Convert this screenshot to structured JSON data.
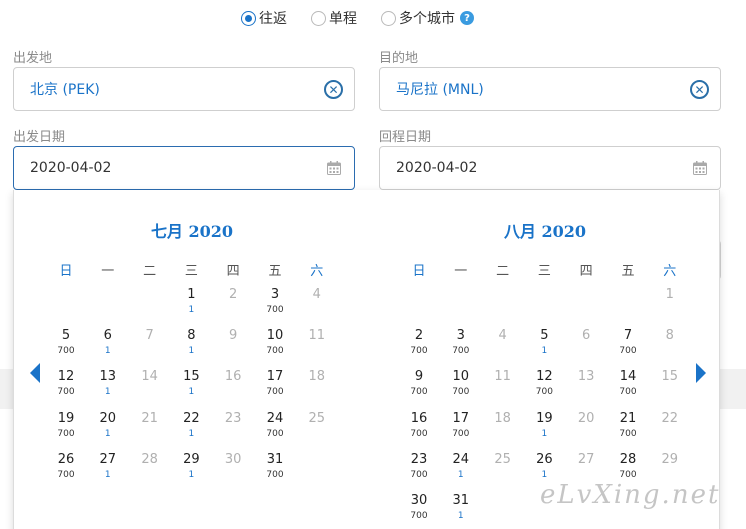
{
  "trip_types": [
    {
      "label": "往返",
      "checked": true
    },
    {
      "label": "单程",
      "checked": false
    },
    {
      "label": "多个城市",
      "checked": false,
      "help": "?"
    }
  ],
  "origin": {
    "label": "出发地",
    "value": "北京 (PEK)"
  },
  "destination": {
    "label": "目的地",
    "value": "马尼拉 (MNL)"
  },
  "depart_date": {
    "label": "出发日期",
    "value": "2020-04-02"
  },
  "return_date": {
    "label": "回程日期",
    "value": "2020-04-02"
  },
  "calendar": {
    "weekdays": [
      "日",
      "一",
      "二",
      "三",
      "四",
      "五",
      "六"
    ],
    "months": [
      {
        "title": "七月 2020",
        "days": [
          {
            "d": "1",
            "p": "1"
          },
          {
            "d": "2",
            "p": ""
          },
          {
            "d": "3",
            "p": "700"
          },
          {
            "d": "4",
            "p": ""
          },
          {
            "d": "5",
            "p": "700"
          },
          {
            "d": "6",
            "p": "1"
          },
          {
            "d": "7",
            "p": ""
          },
          {
            "d": "8",
            "p": "1"
          },
          {
            "d": "9",
            "p": ""
          },
          {
            "d": "10",
            "p": "700"
          },
          {
            "d": "11",
            "p": ""
          },
          {
            "d": "12",
            "p": "700"
          },
          {
            "d": "13",
            "p": "1"
          },
          {
            "d": "14",
            "p": ""
          },
          {
            "d": "15",
            "p": "1"
          },
          {
            "d": "16",
            "p": ""
          },
          {
            "d": "17",
            "p": "700"
          },
          {
            "d": "18",
            "p": ""
          },
          {
            "d": "19",
            "p": "700"
          },
          {
            "d": "20",
            "p": "1"
          },
          {
            "d": "21",
            "p": ""
          },
          {
            "d": "22",
            "p": "1"
          },
          {
            "d": "23",
            "p": ""
          },
          {
            "d": "24",
            "p": "700"
          },
          {
            "d": "25",
            "p": ""
          },
          {
            "d": "26",
            "p": "700"
          },
          {
            "d": "27",
            "p": "1"
          },
          {
            "d": "28",
            "p": ""
          },
          {
            "d": "29",
            "p": "1"
          },
          {
            "d": "30",
            "p": ""
          },
          {
            "d": "31",
            "p": "700"
          }
        ]
      },
      {
        "title": "八月 2020",
        "days": [
          {
            "d": "1",
            "p": ""
          },
          {
            "d": "2",
            "p": "700"
          },
          {
            "d": "3",
            "p": "700"
          },
          {
            "d": "4",
            "p": ""
          },
          {
            "d": "5",
            "p": "1"
          },
          {
            "d": "6",
            "p": ""
          },
          {
            "d": "7",
            "p": "700"
          },
          {
            "d": "8",
            "p": ""
          },
          {
            "d": "9",
            "p": "700"
          },
          {
            "d": "10",
            "p": "700"
          },
          {
            "d": "11",
            "p": ""
          },
          {
            "d": "12",
            "p": "700"
          },
          {
            "d": "13",
            "p": ""
          },
          {
            "d": "14",
            "p": "700"
          },
          {
            "d": "15",
            "p": ""
          },
          {
            "d": "16",
            "p": "700"
          },
          {
            "d": "17",
            "p": "700"
          },
          {
            "d": "18",
            "p": ""
          },
          {
            "d": "19",
            "p": "1"
          },
          {
            "d": "20",
            "p": ""
          },
          {
            "d": "21",
            "p": "700"
          },
          {
            "d": "22",
            "p": ""
          },
          {
            "d": "23",
            "p": "700"
          },
          {
            "d": "24",
            "p": "1"
          },
          {
            "d": "25",
            "p": ""
          },
          {
            "d": "26",
            "p": "1"
          },
          {
            "d": "27",
            "p": ""
          },
          {
            "d": "28",
            "p": "700"
          },
          {
            "d": "29",
            "p": ""
          },
          {
            "d": "30",
            "p": "700"
          },
          {
            "d": "31",
            "p": "1"
          }
        ]
      }
    ]
  },
  "watermark": "eLvXing.net",
  "colors": {
    "accent": "#1a73c8",
    "disabled": "#b0b0b0"
  }
}
